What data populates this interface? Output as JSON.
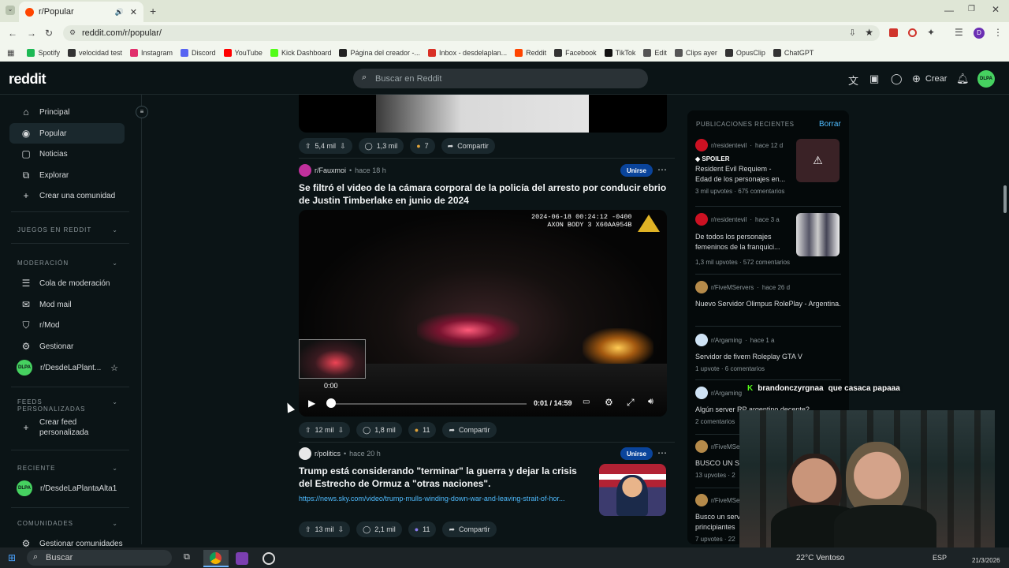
{
  "browser": {
    "tab_title": "r/Popular",
    "url": "reddit.com/r/popular/",
    "profile_initial": "D",
    "bookmarks": [
      {
        "label": "Spotify",
        "color": "#1db954"
      },
      {
        "label": "velocidad test",
        "color": "#333"
      },
      {
        "label": "Instagram",
        "color": "#e1306c"
      },
      {
        "label": "Discord",
        "color": "#5865f2"
      },
      {
        "label": "YouTube",
        "color": "#ff0000"
      },
      {
        "label": "Kick Dashboard",
        "color": "#53fc18"
      },
      {
        "label": "Página del creador -...",
        "color": "#222"
      },
      {
        "label": "Inbox - desdelaplan...",
        "color": "#d93025"
      },
      {
        "label": "Reddit",
        "color": "#ff4500"
      },
      {
        "label": "Facebook",
        "color": "#333"
      },
      {
        "label": "TikTok",
        "color": "#111"
      },
      {
        "label": "Edit",
        "color": "#555"
      },
      {
        "label": "Clips ayer",
        "color": "#555"
      },
      {
        "label": "OpusClip",
        "color": "#333"
      },
      {
        "label": "ChatGPT",
        "color": "#333"
      }
    ]
  },
  "header": {
    "logo": "reddit",
    "search_placeholder": "Buscar en Reddit",
    "create_label": "Crear",
    "avatar_text": "DLPA"
  },
  "sidebar": {
    "main": [
      {
        "label": "Principal",
        "icon": "home-icon"
      },
      {
        "label": "Popular",
        "icon": "popular-icon"
      },
      {
        "label": "Noticias",
        "icon": "news-icon"
      },
      {
        "label": "Explorar",
        "icon": "explore-icon"
      },
      {
        "label": "Crear una comunidad",
        "icon": "plus-icon"
      }
    ],
    "games_section": "JUEGOS EN REDDIT",
    "mod_section": "MODERACIÓN",
    "mod_items": [
      {
        "label": "Cola de moderación"
      },
      {
        "label": "Mod mail"
      },
      {
        "label": "r/Mod"
      },
      {
        "label": "Gestionar"
      },
      {
        "label": "r/DesdeLaPlant..."
      }
    ],
    "feeds_section": "FEEDS PERSONALIZADAS",
    "create_feed_line1": "Crear feed",
    "create_feed_line2": "personalizada",
    "recent_section": "RECIENTE",
    "recent_item": "r/DesdeLaPlantaAlta1",
    "communities_section": "COMUNIDADES",
    "manage_communities": "Gestionar comunidades"
  },
  "feed": {
    "top_post": {
      "upvotes": "5,4 mil",
      "comments": "1,3 mil",
      "awards": "7",
      "share": "Compartir"
    },
    "post1": {
      "subreddit": "r/Fauxmoi",
      "time": "hace 18 h",
      "join": "Unirse",
      "title": "Se filtró el video de la cámara corporal de la policía del arresto por conducir ebrio de Justin Timberlake en junio de 2024",
      "video_stamp_line1": "2024-06-18 00:24:12 -0400",
      "video_stamp_line2": "AXON BODY 3 X60AA954B",
      "preview_time": "0:00",
      "time_display": "0:01 / 14:59",
      "progress": 0.001,
      "upvotes": "12 mil",
      "comments": "1,8 mil",
      "awards": "11",
      "share": "Compartir"
    },
    "post2": {
      "subreddit": "r/politics",
      "time": "hace 20 h",
      "join": "Unirse",
      "title": "Trump está considerando \"terminar\" la guerra y dejar la crisis del Estrecho de Ormuz a \"otras naciones\".",
      "link": "https://news.sky.com/video/trump-mulls-winding-down-war-and-leaving-strait-of-hor...",
      "upvotes": "13 mil",
      "comments": "2,1 mil",
      "awards": "11",
      "share": "Compartir"
    }
  },
  "recent": {
    "heading": "PUBLICACIONES RECIENTES",
    "clear": "Borrar",
    "items": [
      {
        "sub": "r/residentevil",
        "time": "hace 12 d",
        "spoiler": "SPOILER",
        "title": "Resident Evil Requiem - Edad de los personajes en...",
        "stats": "3 mil upvotes · 675 comentarios"
      },
      {
        "sub": "r/residentevil",
        "time": "hace 3 a",
        "title": "De todos los personajes femeninos de la franquici...",
        "stats": "1,3 mil upvotes · 572 comentarios"
      },
      {
        "sub": "r/FiveMServers",
        "time": "hace 26 d",
        "title": "Nuevo Servidor Olimpus RolePlay - Argentina.",
        "stats": ""
      },
      {
        "sub": "r/Argaming",
        "time": "hace 1 a",
        "title": "Servidor de fivem Roleplay GTA V",
        "stats": "1 upvote · 6 comentarios"
      },
      {
        "sub": "r/Argaming",
        "time": "",
        "title": "Algún server RP argentino decente?",
        "stats": "2 comentarios"
      },
      {
        "sub": "r/FiveMSe",
        "time": "",
        "title": "BUSCO UN SE",
        "stats": "13 upvotes · 2"
      },
      {
        "sub": "r/FiveMSe",
        "time": "",
        "title": "Busco un serv principiantes",
        "stats": "7 upvotes · 22"
      }
    ]
  },
  "chat_overlay": {
    "user": "brandonczyrgnaa",
    "message": "que casaca papaaa"
  },
  "taskbar": {
    "search": "Buscar",
    "weather": "22°C  Ventoso",
    "lang": "ESP",
    "date": "21/3/2026"
  }
}
